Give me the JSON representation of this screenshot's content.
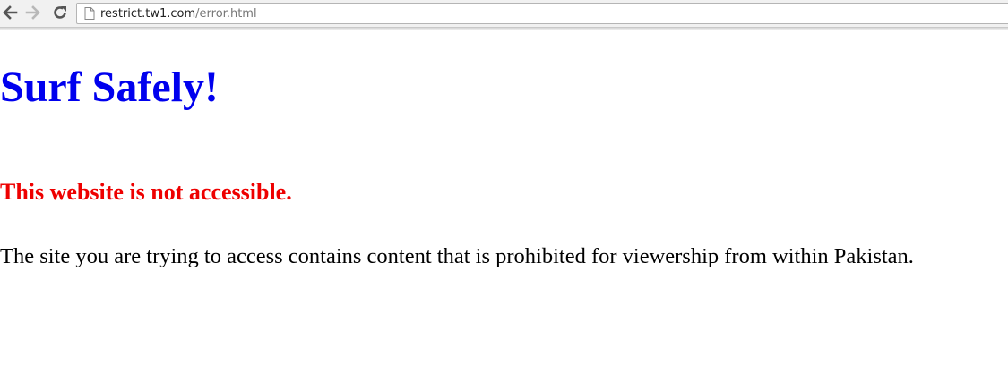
{
  "browser": {
    "url_host": "restrict.tw1.com",
    "url_path": "/error.html"
  },
  "page": {
    "title": "Surf Safely!",
    "subtitle": "This website is not accessible.",
    "message": "The site you are trying to access contains content that is prohibited for viewership from within Pakistan."
  },
  "colors": {
    "title": "#0000ee",
    "subtitle": "#ee0000",
    "message": "#000000"
  }
}
